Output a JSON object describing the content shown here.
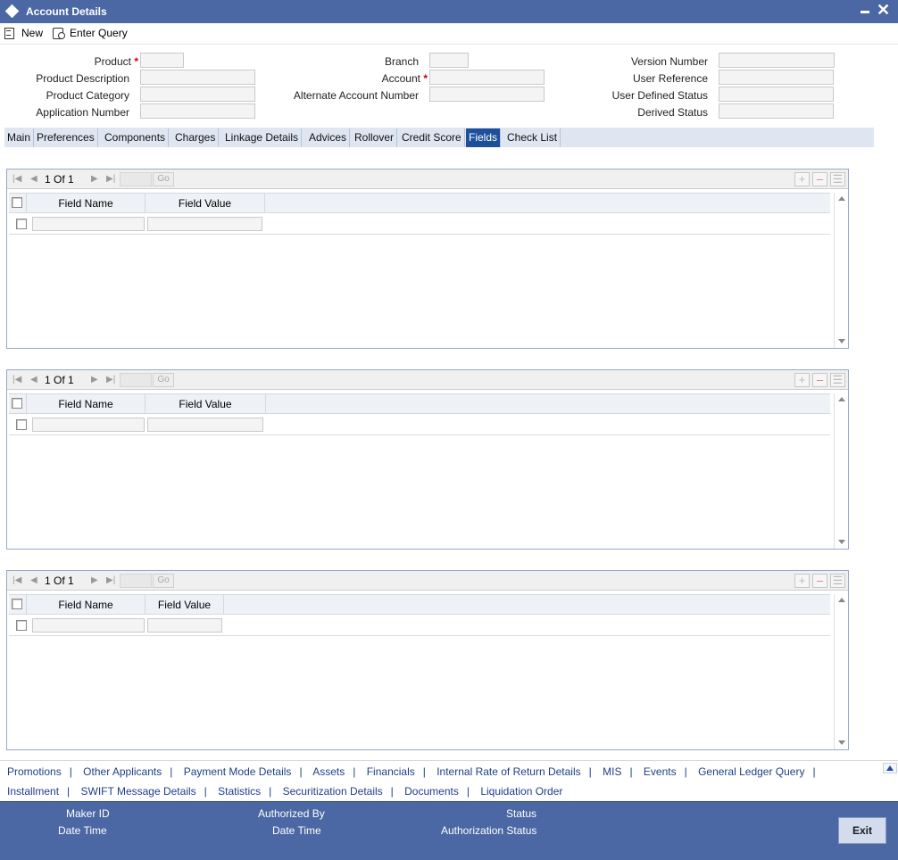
{
  "window": {
    "title": "Account Details"
  },
  "toolbar": {
    "new_label": "New",
    "query_label": "Enter Query"
  },
  "header": {
    "product_label": "Product",
    "product_desc_label": "Product Description",
    "product_category_label": "Product Category",
    "application_number_label": "Application Number",
    "branch_label": "Branch",
    "account_label": "Account",
    "alt_account_label": "Alternate Account Number",
    "version_label": "Version Number",
    "user_ref_label": "User Reference",
    "user_status_label": "User Defined Status",
    "derived_status_label": "Derived Status",
    "required_mark": "*"
  },
  "tabs": [
    "Main",
    "Preferences",
    "Components",
    "Charges",
    "Linkage Details",
    "Advices",
    "Rollover",
    "Credit Score",
    "Fields",
    "Check List"
  ],
  "active_tab": "Fields",
  "grids": [
    {
      "page_info": "1 Of 1",
      "go_label": "Go",
      "col_name": "Field Name",
      "col_value": "Field Value"
    },
    {
      "page_info": "1 Of 1",
      "go_label": "Go",
      "col_name": "Field Name",
      "col_value": "Field Value"
    },
    {
      "page_info": "1 Of 1",
      "go_label": "Go",
      "col_name": "Field Name",
      "col_value": "Field Value"
    }
  ],
  "links_row1": [
    "Promotions",
    "Other Applicants",
    "Payment Mode Details",
    "Assets",
    "Financials",
    "Internal Rate of Return Details",
    "MIS",
    "Events",
    "General Ledger Query"
  ],
  "links_row2": [
    "Installment",
    "SWIFT Message Details",
    "Statistics",
    "Securitization Details",
    "Documents",
    "Liquidation Order"
  ],
  "link_separator": "|",
  "footer": {
    "maker_id": "Maker ID",
    "date_time": "Date Time",
    "authorized_by": "Authorized By",
    "date_time_2": "Date Time",
    "status": "Status",
    "authorization_status": "Authorization Status",
    "exit_label": "Exit"
  }
}
